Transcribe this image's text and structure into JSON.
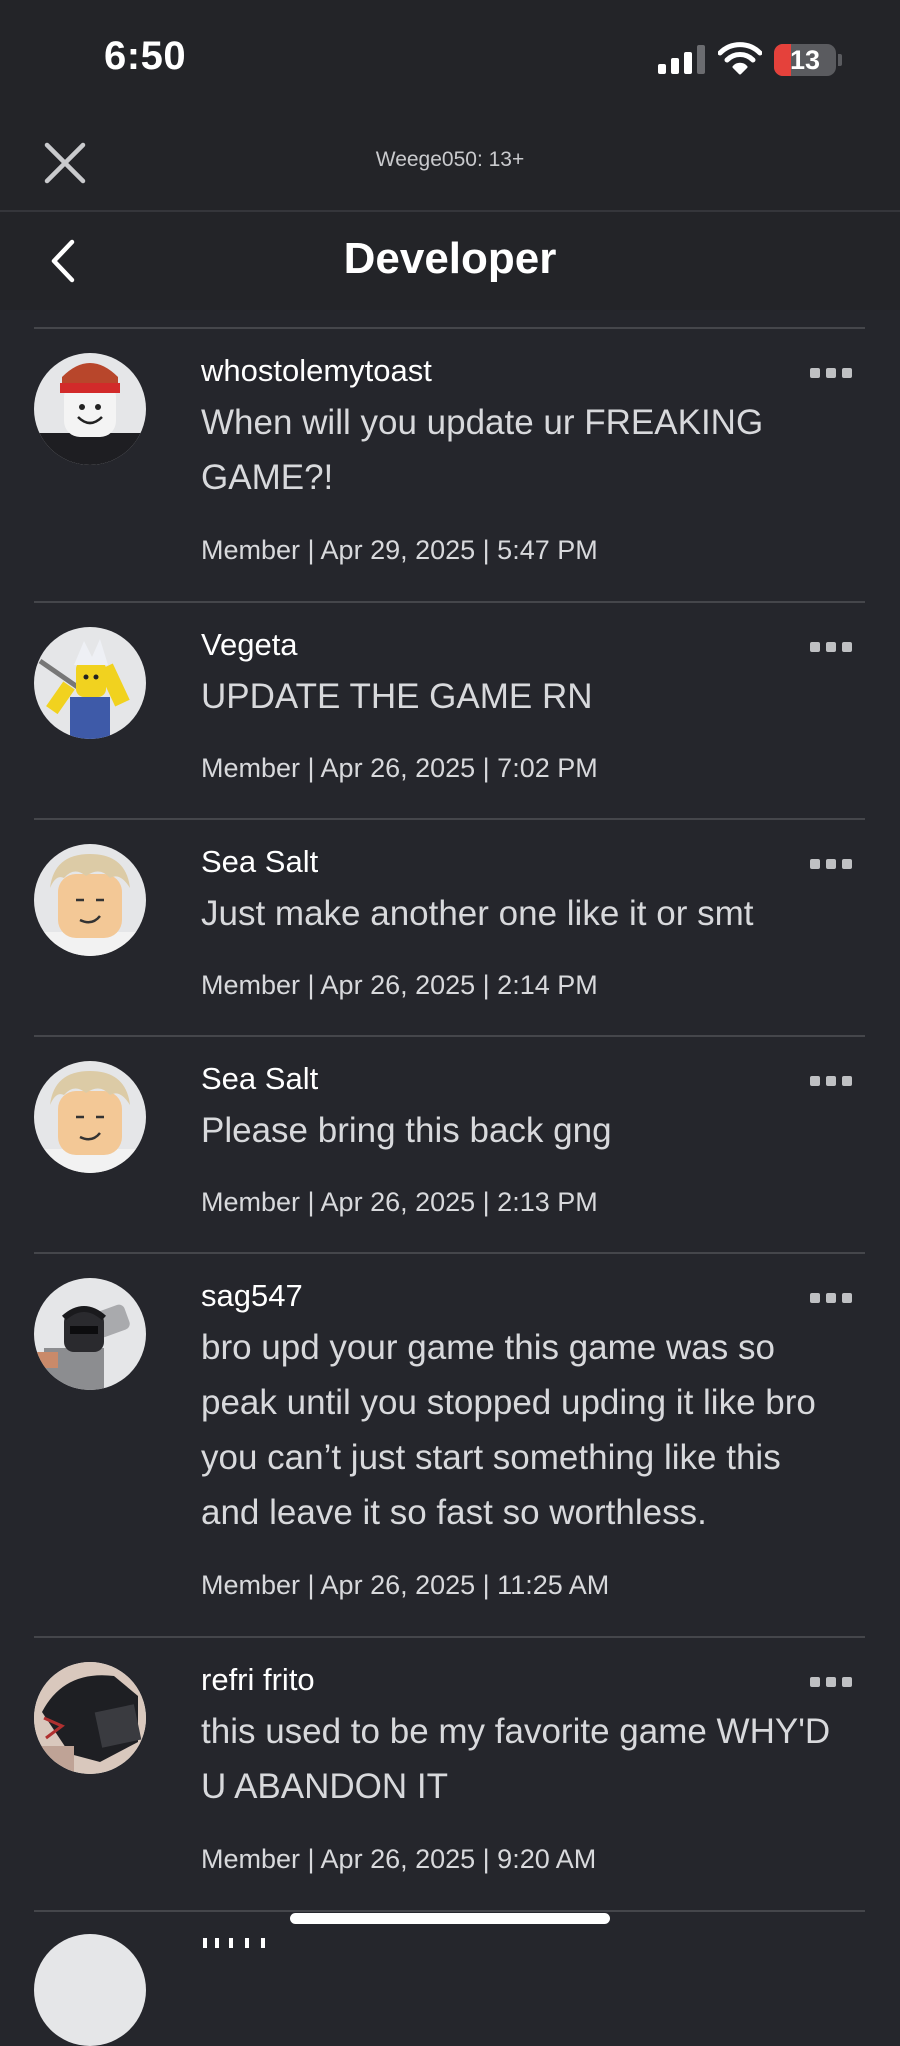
{
  "status_bar": {
    "time": "6:50",
    "battery_level": "13",
    "battery_percent": 13,
    "icons": [
      "cellular-signal-icon",
      "wifi-icon",
      "battery-icon"
    ]
  },
  "web_header": {
    "title": "Weege050: 13+",
    "close_icon": "close-icon"
  },
  "nav": {
    "title": "Developer",
    "back_icon": "chevron-left-icon"
  },
  "comments": [
    {
      "username": "whostolemytoast",
      "message": "When will you update ur FREAKING GAME?!",
      "meta": "Member | Apr 29, 2025 | 5:47 PM"
    },
    {
      "username": "Vegeta",
      "message": "UPDATE THE GAME RN",
      "meta": "Member | Apr 26, 2025 | 7:02 PM"
    },
    {
      "username": "Sea Salt",
      "message": "Just make another one like it or smt",
      "meta": "Member | Apr 26, 2025 | 2:14 PM"
    },
    {
      "username": "Sea Salt",
      "message": "Please bring this back gng",
      "meta": "Member | Apr 26, 2025 | 2:13 PM"
    },
    {
      "username": "sag547",
      "message": "bro upd your game this game was so peak until you stopped upding it like bro you can’t just start something like this and leave it so fast so worthless.",
      "meta": "Member | Apr 26, 2025 | 11:25 AM"
    },
    {
      "username": "refri frito",
      "message": "this used to be my favorite game WHY'D U ABANDON IT",
      "meta": "Member | Apr 26, 2025 | 9:20 AM"
    }
  ],
  "colors": {
    "background": "#25262c",
    "header": "#232428",
    "divider": "#45464b",
    "text_primary": "#ffffff",
    "text_secondary": "#d8d9dc",
    "battery_low": "#e5413b"
  }
}
